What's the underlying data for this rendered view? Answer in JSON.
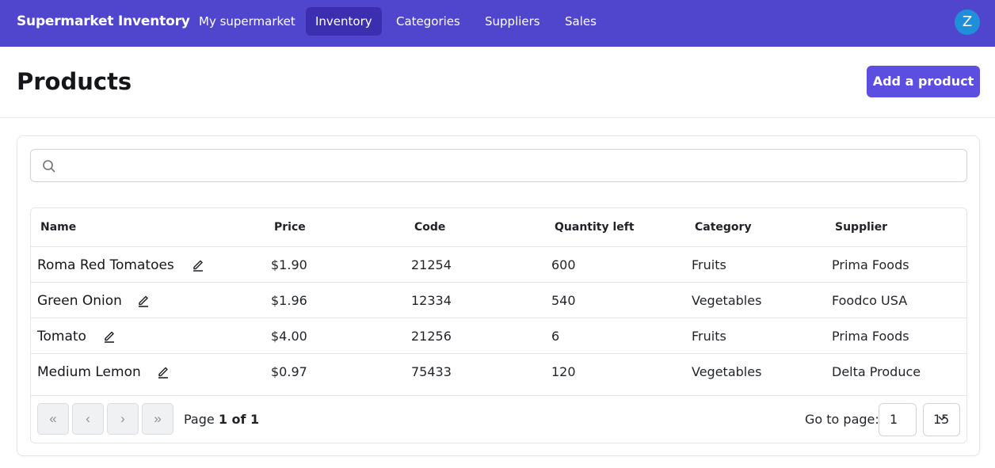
{
  "app": {
    "title": "Supermarket Inventory"
  },
  "nav": {
    "items": [
      {
        "label": "My supermarket",
        "active": false
      },
      {
        "label": "Inventory",
        "active": true
      },
      {
        "label": "Categories",
        "active": false
      },
      {
        "label": "Suppliers",
        "active": false
      },
      {
        "label": "Sales",
        "active": false
      }
    ],
    "avatar_initial": "Z"
  },
  "page": {
    "title": "Products",
    "add_button": "Add a product"
  },
  "search": {
    "value": "",
    "placeholder": "",
    "icon": "search-icon"
  },
  "table": {
    "columns": [
      "Name",
      "Price",
      "Code",
      "Quantity left",
      "Category",
      "Supplier"
    ],
    "rows": [
      {
        "name": "Roma Red Tomatoes",
        "price": "$1.90",
        "code": "21254",
        "quantity": "600",
        "category": "Fruits",
        "supplier": "Prima Foods"
      },
      {
        "name": "Green Onion",
        "price": "$1.96",
        "code": "12334",
        "quantity": "540",
        "category": "Vegetables",
        "supplier": "Foodco USA"
      },
      {
        "name": "Tomato",
        "price": "$4.00",
        "code": "21256",
        "quantity": "6",
        "category": "Fruits",
        "supplier": "Prima Foods"
      },
      {
        "name": "Medium Lemon",
        "price": "$0.97",
        "code": "75433",
        "quantity": "120",
        "category": "Vegetables",
        "supplier": "Delta Produce"
      }
    ]
  },
  "pagination": {
    "page_prefix": "Page",
    "page_value": "1 of 1",
    "goto_label": "Go to page:",
    "goto_value": "1",
    "page_size": "15",
    "buttons": {
      "first": "«",
      "prev": "‹",
      "next": "›",
      "last": "»"
    }
  },
  "colors": {
    "nav_bg": "#5046cd",
    "nav_active": "#3b2fb0",
    "accent_button": "#5b4ee0",
    "avatar": "#1e8fd8"
  }
}
